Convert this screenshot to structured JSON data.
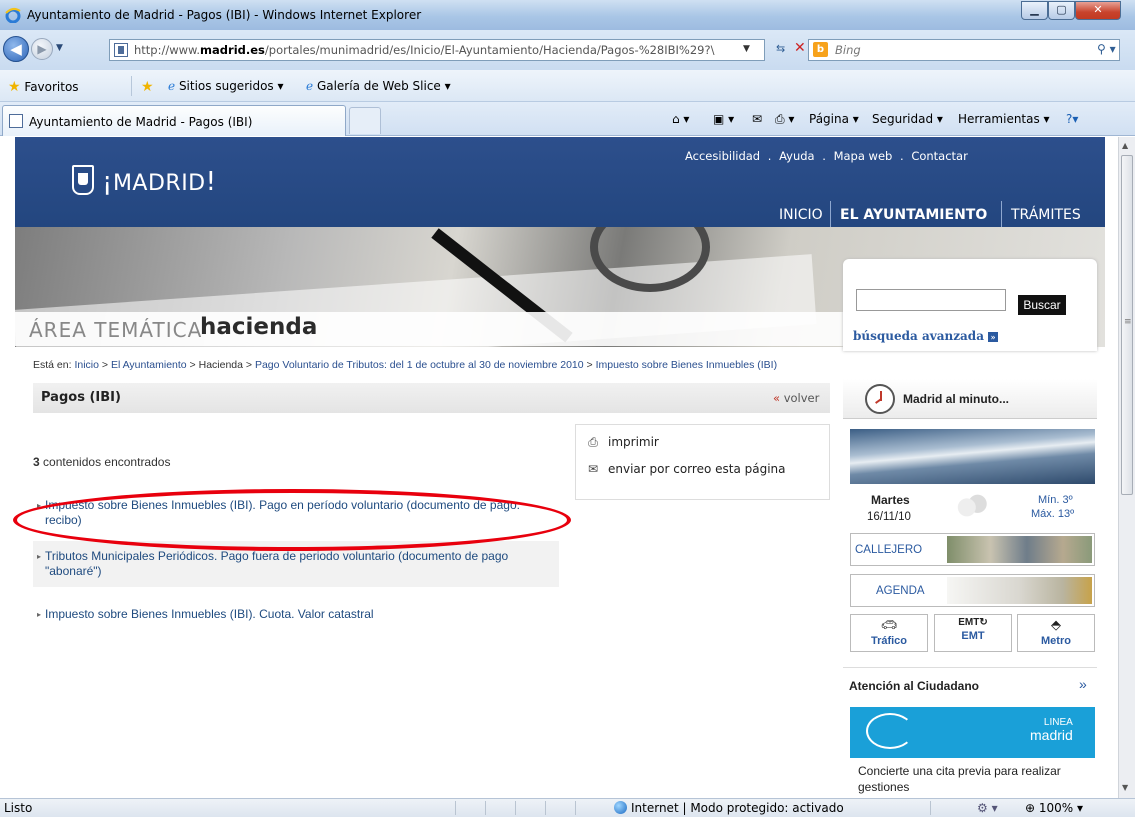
{
  "window": {
    "title": "Ayuntamiento de Madrid - Pagos (IBI) - Windows Internet Explorer"
  },
  "address": {
    "url_prefix": "http://www.",
    "url_domain": "madrid.es",
    "url_path": "/portales/munimadrid/es/Inicio/El-Ayuntamiento/Hacienda/Pagos-%28IBI%29?\\",
    "search_placeholder": "Bing"
  },
  "favorites_bar": {
    "favorites": "Favoritos",
    "suggested": "Sitios sugeridos ▾",
    "webslice": "Galería de Web Slice ▾"
  },
  "tabs": [
    {
      "label": "Ayuntamiento de Madrid - Pagos (IBI)"
    }
  ],
  "command_bar": {
    "page": "Página ▾",
    "security": "Seguridad ▾",
    "tools": "Herramientas ▾",
    "help": "?▾"
  },
  "header": {
    "logo": "MADRID",
    "top_links": [
      "Accesibilidad",
      "Ayuda",
      "Mapa web",
      "Contactar"
    ],
    "nav": [
      "INICIO",
      "EL AYUNTAMIENTO",
      "TRÁMITES"
    ]
  },
  "area": {
    "label": "ÁREA TEMÁTICA",
    "name": "hacienda"
  },
  "search": {
    "button": "Buscar",
    "advanced": "búsqueda avanzada"
  },
  "breadcrumb": {
    "prefix": "Está en:",
    "items": [
      "Inicio",
      "El Ayuntamiento",
      "Hacienda",
      "Pago Voluntario de Tributos: del 1 de octubre al 30 de noviembre 2010",
      "Impuesto sobre Bienes Inmuebles (IBI)"
    ]
  },
  "content": {
    "title": "Pagos (IBI)",
    "back": "volver",
    "count": "3",
    "count_label": "contenidos encontrados",
    "tools": [
      "imprimir",
      "enviar por correo esta página"
    ],
    "results": [
      "Impuesto sobre Bienes Inmuebles (IBI). Pago en período voluntario (documento de pago: recibo)",
      "Tributos Municipales Periódicos. Pago fuera de periodo voluntario (documento de pago \"abonaré\")",
      "Impuesto sobre Bienes Inmuebles (IBI). Cuota. Valor catastral"
    ]
  },
  "sidebar": {
    "minuto": "Madrid al minuto...",
    "weather": {
      "day": "Martes",
      "date": "16/11/10",
      "min": "Mín. 3º",
      "max": "Máx. 13º"
    },
    "callejero": "CALLEJERO",
    "agenda": "AGENDA",
    "transport": [
      "Tráfico",
      "EMT",
      "Metro"
    ],
    "atencion": "Atención al Ciudadano",
    "atencion_more": "»",
    "linea": {
      "line1": "LINEA",
      "line2": "madrid"
    },
    "cita": "Concierte una cita previa para realizar gestiones"
  },
  "status": {
    "left": "Listo",
    "zone": "Internet | Modo protegido: activado",
    "zoom": "100%"
  },
  "colors": {
    "header_blue": "#23467f",
    "link_blue": "#1e4a7f",
    "highlight_oval": "#e8000d",
    "linea_blue": "#1aa0d8"
  }
}
